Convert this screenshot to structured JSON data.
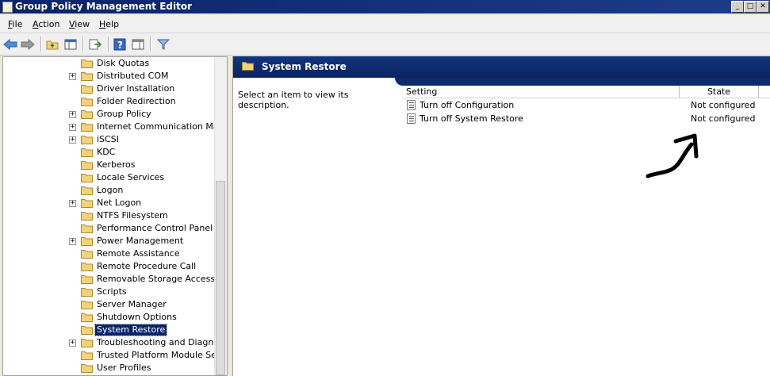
{
  "window": {
    "title": "Group Policy Management Editor",
    "controls": [
      "minimize",
      "maximize",
      "close"
    ]
  },
  "menu": {
    "items": [
      "File",
      "Action",
      "View",
      "Help"
    ]
  },
  "toolbar": {
    "icons": [
      "back-arrow-icon",
      "forward-arrow-icon",
      "up-folder-icon",
      "show-hide-tree-icon",
      "export-list-icon",
      "help-icon",
      "show-hide-action-pane-icon",
      "filter-icon"
    ]
  },
  "tree": {
    "items": [
      {
        "label": "Disk Quotas",
        "expandable": false
      },
      {
        "label": "Distributed COM",
        "expandable": true
      },
      {
        "label": "Driver Installation",
        "expandable": false
      },
      {
        "label": "Folder Redirection",
        "expandable": false
      },
      {
        "label": "Group Policy",
        "expandable": true
      },
      {
        "label": "Internet Communication Manage",
        "expandable": true
      },
      {
        "label": "iSCSI",
        "expandable": true
      },
      {
        "label": "KDC",
        "expandable": false
      },
      {
        "label": "Kerberos",
        "expandable": false
      },
      {
        "label": "Locale Services",
        "expandable": false
      },
      {
        "label": "Logon",
        "expandable": false
      },
      {
        "label": "Net Logon",
        "expandable": true
      },
      {
        "label": "NTFS Filesystem",
        "expandable": false
      },
      {
        "label": "Performance Control Panel",
        "expandable": false
      },
      {
        "label": "Power Management",
        "expandable": true
      },
      {
        "label": "Remote Assistance",
        "expandable": false
      },
      {
        "label": "Remote Procedure Call",
        "expandable": false
      },
      {
        "label": "Removable Storage Access",
        "expandable": false
      },
      {
        "label": "Scripts",
        "expandable": false
      },
      {
        "label": "Server Manager",
        "expandable": false
      },
      {
        "label": "Shutdown Options",
        "expandable": false
      },
      {
        "label": "System Restore",
        "expandable": false,
        "selected": true
      },
      {
        "label": "Troubleshooting and Diagnostic",
        "expandable": true
      },
      {
        "label": "Trusted Platform Module Service",
        "expandable": false
      },
      {
        "label": "User Profiles",
        "expandable": false
      }
    ]
  },
  "details": {
    "title": "System Restore",
    "description": "Select an item to view its description.",
    "columns": {
      "setting": "Setting",
      "state": "State"
    },
    "rows": [
      {
        "setting": "Turn off Configuration",
        "state": "Not configured"
      },
      {
        "setting": "Turn off System Restore",
        "state": "Not configured"
      }
    ]
  },
  "colors": {
    "title_bar": "#0a246a",
    "header_bar": "#0d2b6b",
    "selection": "#0a246a",
    "folder": "#f3d27a"
  }
}
